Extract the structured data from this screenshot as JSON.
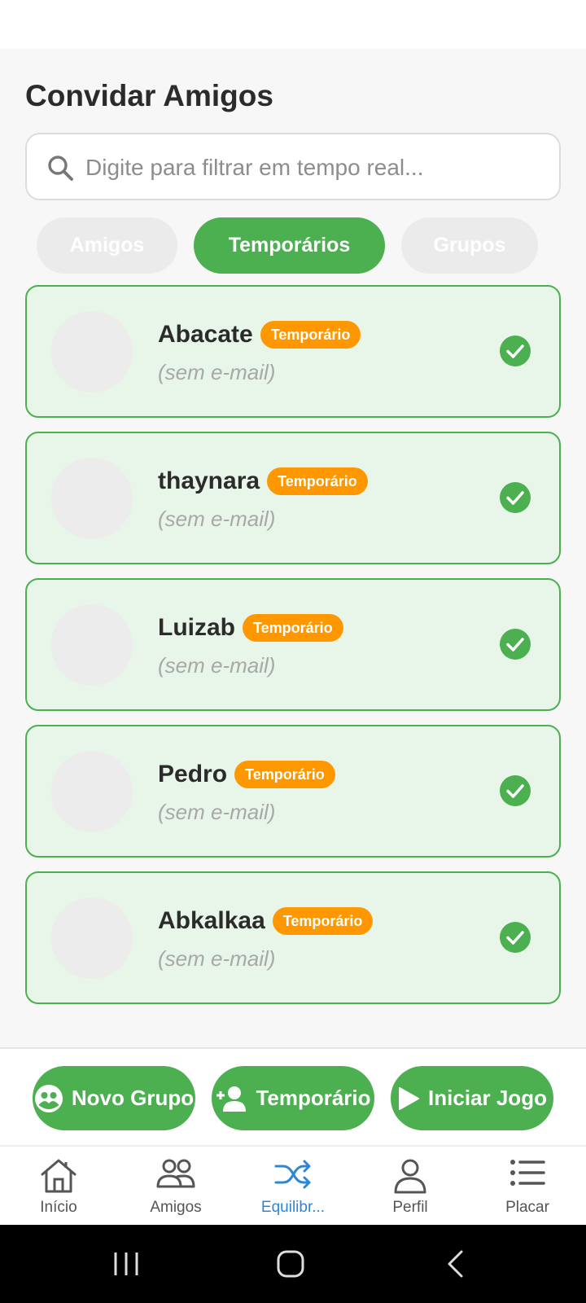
{
  "page": {
    "title": "Convidar Amigos"
  },
  "search": {
    "placeholder": "Digite para filtrar em tempo real..."
  },
  "tabs": [
    {
      "label": "Amigos",
      "active": false
    },
    {
      "label": "Temporários",
      "active": true
    },
    {
      "label": "Grupos",
      "active": false
    }
  ],
  "contacts": [
    {
      "name": "Abacate",
      "badge": "Temporário",
      "email": "(sem e-mail)",
      "selected": true
    },
    {
      "name": "thaynara",
      "badge": "Temporário",
      "email": "(sem e-mail)",
      "selected": true
    },
    {
      "name": "Luizab",
      "badge": "Temporário",
      "email": "(sem e-mail)",
      "selected": true
    },
    {
      "name": "Pedro",
      "badge": "Temporário",
      "email": "(sem e-mail)",
      "selected": true
    },
    {
      "name": "Abkalkaa",
      "badge": "Temporário",
      "email": "(sem e-mail)",
      "selected": true
    }
  ],
  "actions": [
    {
      "label": "Novo Grupo",
      "icon": "group-icon"
    },
    {
      "label": "Temporário",
      "icon": "add-person-icon"
    },
    {
      "label": "Iniciar Jogo",
      "icon": "play-icon"
    }
  ],
  "bottom_nav": [
    {
      "label": "Início",
      "icon": "home-icon",
      "active": false
    },
    {
      "label": "Amigos",
      "icon": "people-icon",
      "active": false
    },
    {
      "label": "Equilibr...",
      "icon": "shuffle-icon",
      "active": true
    },
    {
      "label": "Perfil",
      "icon": "person-icon",
      "active": false
    },
    {
      "label": "Placar",
      "icon": "list-icon",
      "active": false
    }
  ],
  "colors": {
    "primary": "#4caf50",
    "badge": "#ff9800",
    "card_bg": "#e8f5e9",
    "active_nav": "#2f86d6"
  }
}
